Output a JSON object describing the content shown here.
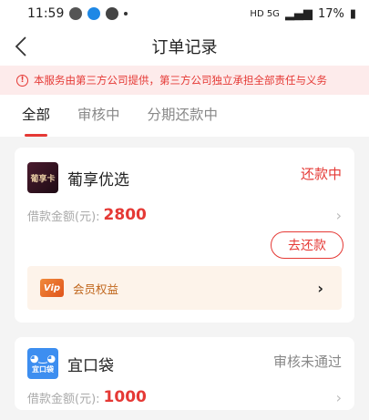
{
  "status_bar": {
    "time": "11:59",
    "network": "HD 5G",
    "battery": "17%"
  },
  "header": {
    "title": "订单记录"
  },
  "notice": {
    "text": "本服务由第三方公司提供，第三方公司独立承担全部责任与义务"
  },
  "tabs": [
    {
      "label": "全部",
      "active": true
    },
    {
      "label": "审核中",
      "active": false
    },
    {
      "label": "分期还款中",
      "active": false
    }
  ],
  "orders": [
    {
      "logo_text": "葡享卡",
      "name": "葡享优选",
      "status": "还款中",
      "amount_label": "借款金额(元):",
      "amount": "2800",
      "action": "去还款",
      "benefit": "会员权益",
      "benefit_badge": "Vip"
    },
    {
      "logo_text": "宜口袋",
      "name": "宜口袋",
      "status": "审核未通过",
      "amount_label": "借款金额(元):",
      "amount": "1000"
    }
  ],
  "colors": {
    "accent": "#e53935",
    "background": "#f4f4f4"
  }
}
